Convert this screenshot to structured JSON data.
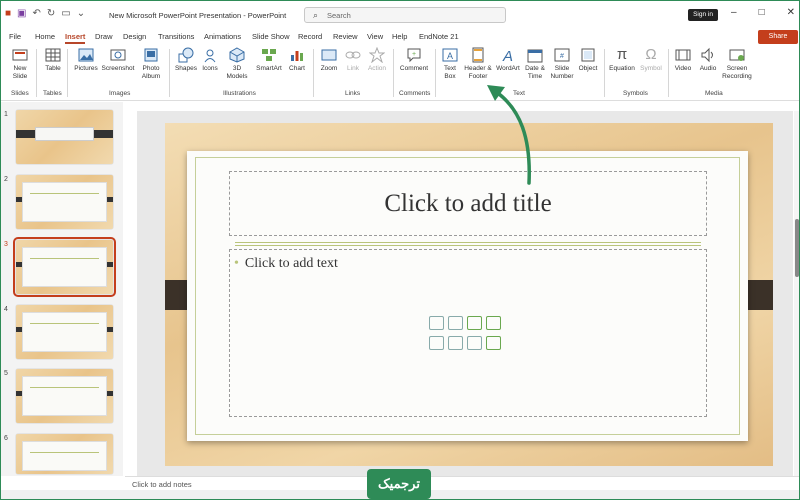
{
  "window": {
    "title": "New Microsoft PowerPoint Presentation  -  PowerPoint",
    "search_placeholder": "Search",
    "signin_label": "Sign in",
    "share_label": "Share",
    "win_min": "–",
    "win_max": "□",
    "win_close": "✕"
  },
  "menu": {
    "tabs": [
      "File",
      "Home",
      "Insert",
      "Draw",
      "Design",
      "Transitions",
      "Animations",
      "Slide Show",
      "Record",
      "Review",
      "View",
      "Help",
      "EndNote 21"
    ]
  },
  "ribbon": {
    "buttons": {
      "new_slide": "New Slide",
      "table": "Table",
      "pictures": "Pictures",
      "screenshot": "Screenshot",
      "photo_album": "Photo Album",
      "shapes": "Shapes",
      "icons": "Icons",
      "models_3d": "3D Models",
      "smartart": "SmartArt",
      "chart": "Chart",
      "zoom": "Zoom",
      "link": "Link",
      "action": "Action",
      "comment": "Comment",
      "text_box": "Text Box",
      "header_footer": "Header & Footer",
      "wordart": "WordArt",
      "date_time": "Date & Time",
      "slide_number": "Slide Number",
      "object": "Object",
      "equation": "Equation",
      "symbol": "Symbol",
      "video": "Video",
      "audio": "Audio",
      "screen_recording": "Screen Recording"
    },
    "groups": {
      "slides": "Slides",
      "tables": "Tables",
      "images": "Images",
      "illustrations": "Illustrations",
      "links": "Links",
      "comments": "Comments",
      "text": "Text",
      "symbols": "Symbols",
      "media": "Media"
    }
  },
  "thumbnails": {
    "numbers": [
      "1",
      "2",
      "3",
      "4",
      "5",
      "6"
    ],
    "selected_index": 2
  },
  "slide": {
    "title_placeholder": "Click to add title",
    "body_placeholder": "Click to add text"
  },
  "notes": {
    "placeholder": "Click to add notes"
  },
  "logo": {
    "text": "ترجمیک"
  },
  "colors": {
    "accent": "#b7472a",
    "share": "#c43e1c",
    "annotation_arrow": "#2e8b57"
  }
}
